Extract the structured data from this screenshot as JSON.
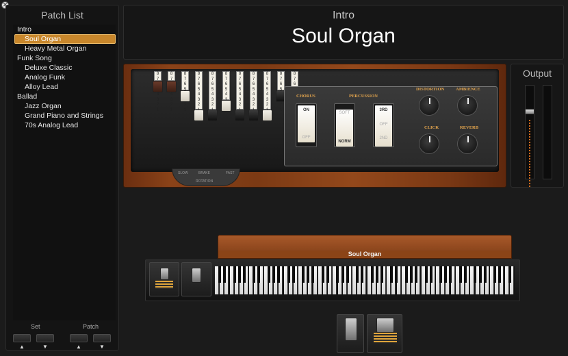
{
  "window": {
    "close_icon": "close-icon"
  },
  "sidebar": {
    "title": "Patch List",
    "items": [
      {
        "label": "Intro",
        "level": 0,
        "selected": false
      },
      {
        "label": "Soul Organ",
        "level": 1,
        "selected": true
      },
      {
        "label": "Heavy Metal Organ",
        "level": 1,
        "selected": false
      },
      {
        "label": "Funk Song",
        "level": 0,
        "selected": false
      },
      {
        "label": "Deluxe Classic",
        "level": 1,
        "selected": false
      },
      {
        "label": "Analog Funk",
        "level": 1,
        "selected": false
      },
      {
        "label": "Alloy Lead",
        "level": 1,
        "selected": false
      },
      {
        "label": "Ballad",
        "level": 0,
        "selected": false
      },
      {
        "label": "Jazz Organ",
        "level": 1,
        "selected": false
      },
      {
        "label": "Grand Piano and Strings",
        "level": 1,
        "selected": false
      },
      {
        "label": "70s Analog Lead",
        "level": 1,
        "selected": false
      }
    ],
    "set_label": "Set",
    "patch_label": "Patch",
    "up_arrow": "▲",
    "down_arrow": "▼"
  },
  "header": {
    "set_name": "Intro",
    "patch_name": "Soul Organ"
  },
  "organ": {
    "drawbar_scale": "8 7 6 5 4 3 2 1",
    "drawbar_levels": [
      2,
      2,
      4,
      8,
      8,
      6,
      8,
      8,
      8,
      4,
      6
    ],
    "drawbar_footages": [
      "16'",
      "5⅓'",
      "8'",
      "4'",
      "2⅔'",
      "2'",
      "1⅗'",
      "1⅓'",
      "1'"
    ],
    "rotation": {
      "slow": "SLOW",
      "brake": "BRAKE",
      "fast": "FAST",
      "label": "ROTATION"
    },
    "chorus": {
      "label": "CHORUS",
      "on": "ON",
      "off": "OFF"
    },
    "percussion": {
      "label": "PERCUSSION",
      "soft": "SOFT",
      "norm": "NORM",
      "third": "3RD",
      "off": "OFF",
      "second": "2ND"
    },
    "knobs": {
      "distortion": "DISTORTION",
      "ambience": "AMBIENCE",
      "click": "CLICK",
      "reverb": "REVERB"
    }
  },
  "output": {
    "title": "Output"
  },
  "keyboard": {
    "label": "Soul Organ"
  }
}
